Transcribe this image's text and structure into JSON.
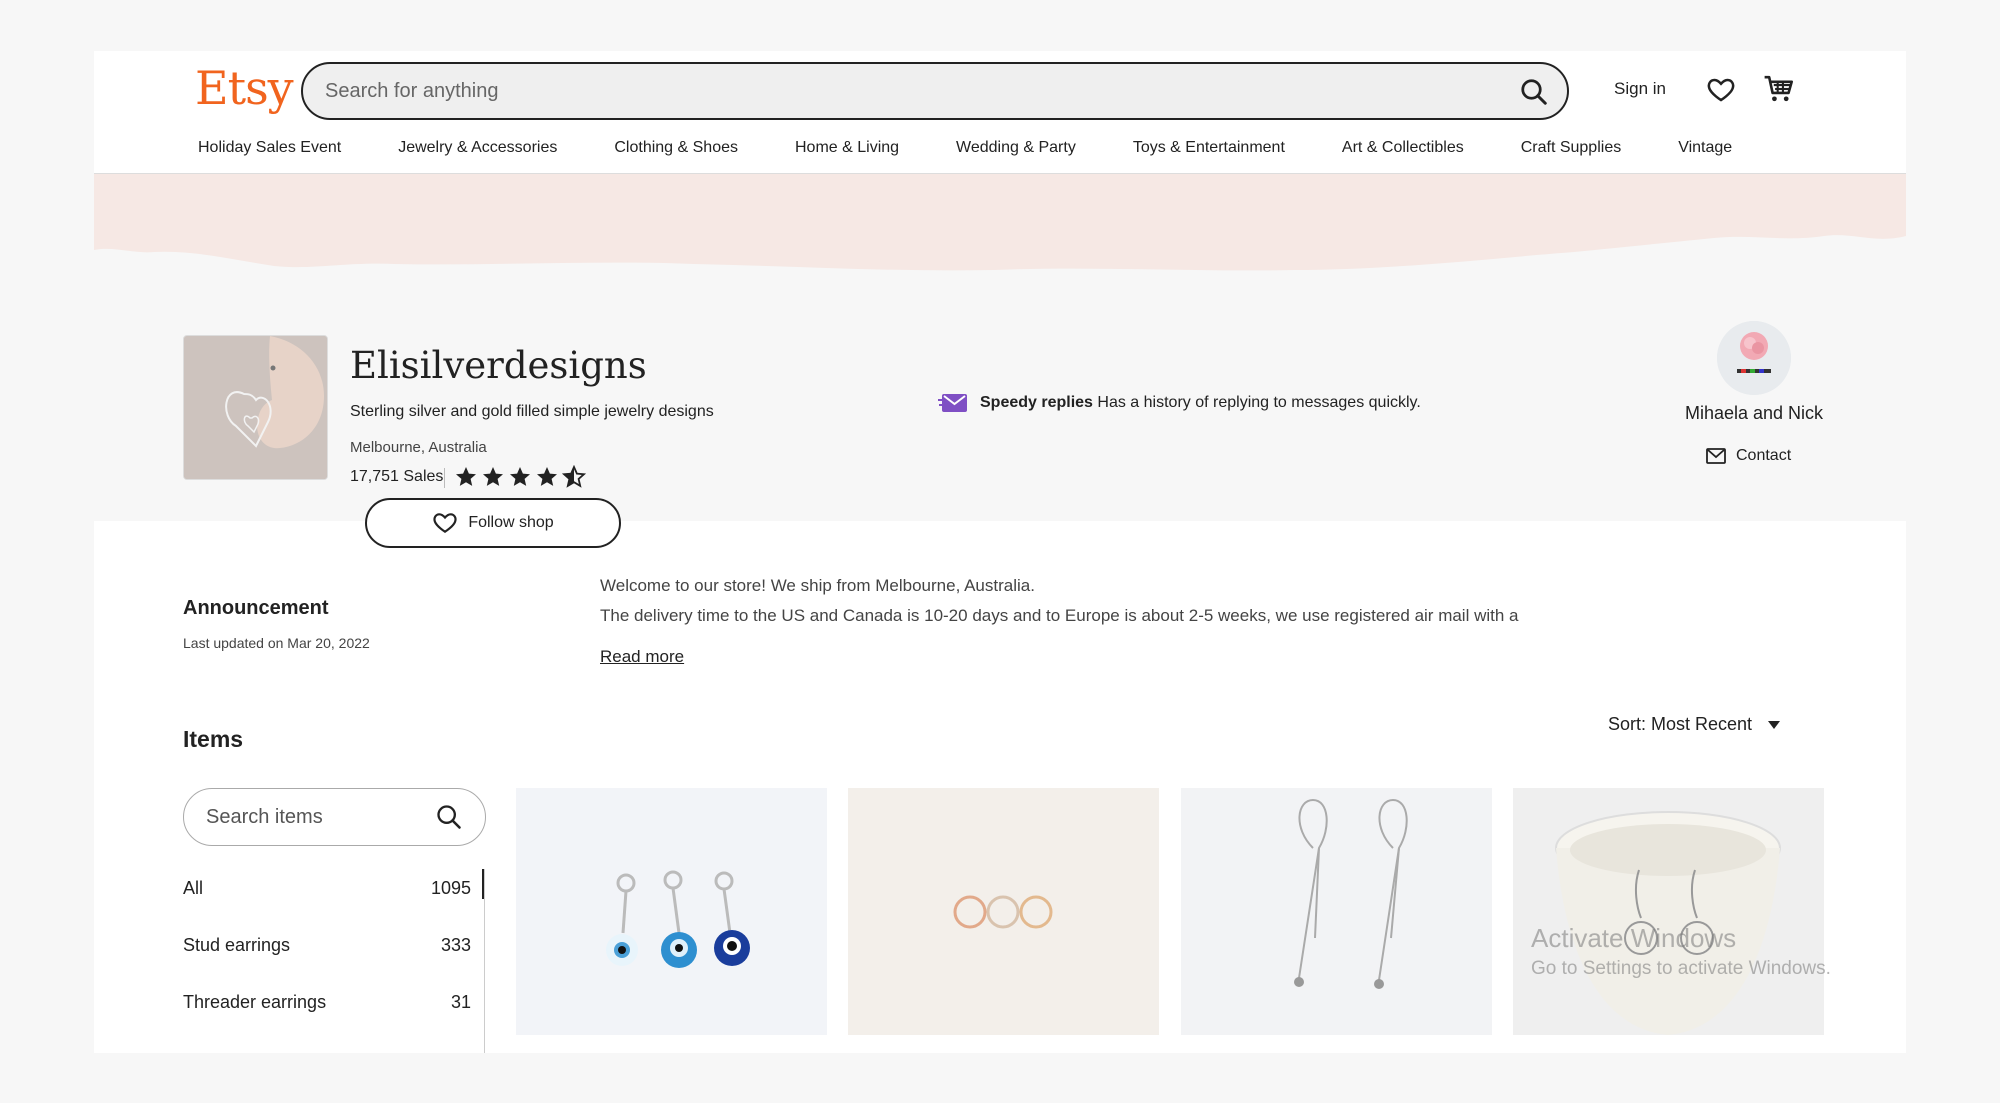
{
  "header": {
    "logo": "Etsy",
    "search_placeholder": "Search for anything",
    "sign_in": "Sign in",
    "categories": [
      "Holiday Sales Event",
      "Jewelry & Accessories",
      "Clothing & Shoes",
      "Home & Living",
      "Wedding & Party",
      "Toys & Entertainment",
      "Art & Collectibles",
      "Craft Supplies",
      "Vintage"
    ]
  },
  "shop": {
    "name": "Elisilverdesigns",
    "tagline": "Sterling silver and gold filled simple jewelry designs",
    "location": "Melbourne, Australia",
    "sales": "17,751 Sales",
    "rating": 4.5,
    "follow_label": "Follow shop",
    "speedy_title": "Speedy replies",
    "speedy_text": "Has a history of replying to messages quickly.",
    "owner_name": "Mihaela and Nick",
    "contact_label": "Contact"
  },
  "announcement": {
    "title": "Announcement",
    "updated": "Last updated on Mar 20, 2022",
    "line1": "Welcome to our store! We ship from Melbourne, Australia.",
    "line2": "The delivery time to the US and Canada is 10-20 days and to Europe is about 2-5 weeks, we use registered air mail with a",
    "read_more": "Read more"
  },
  "items": {
    "title": "Items",
    "sort_label": "Sort: Most Recent",
    "search_placeholder": "Search items",
    "categories": [
      {
        "label": "All",
        "count": "1095"
      },
      {
        "label": "Stud earrings",
        "count": "333"
      },
      {
        "label": "Threader earrings",
        "count": "31"
      }
    ]
  },
  "watermark": {
    "line1": "Activate Windows",
    "line2": "Go to Settings to activate Windows."
  },
  "colors": {
    "brand": "#f1641e",
    "banner": "#f6e8e4"
  }
}
